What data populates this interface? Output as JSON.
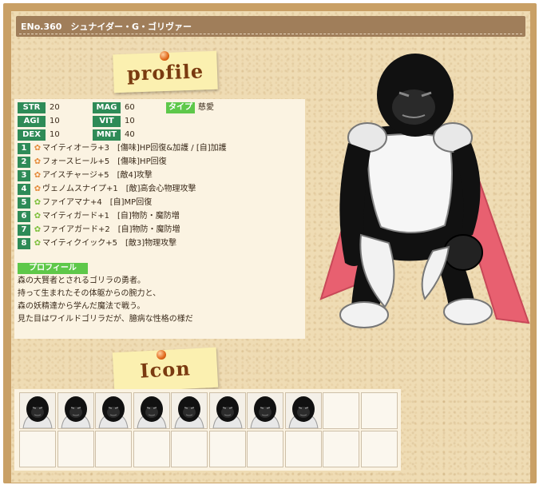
{
  "header": {
    "title": "ENo.360　シュナイダー・G・ゴリヴァー"
  },
  "notes": {
    "profile_word": "profile",
    "icon_word": "Icon"
  },
  "stats": [
    {
      "label": "STR",
      "value": "20"
    },
    {
      "label": "AGI",
      "value": "10"
    },
    {
      "label": "DEX",
      "value": "10"
    },
    {
      "label": "MAG",
      "value": "60"
    },
    {
      "label": "VIT",
      "value": "10"
    },
    {
      "label": "MNT",
      "value": "40"
    }
  ],
  "type": {
    "label": "タイプ",
    "value": "慈愛"
  },
  "skills": [
    {
      "num": "1",
      "flower_color": "#e58a3a",
      "text": "マイティオーラ+3　[傷味]HP回復&加護 / [自]加護"
    },
    {
      "num": "2",
      "flower_color": "#e58a3a",
      "text": "フォースヒール+5　[傷味]HP回復"
    },
    {
      "num": "3",
      "flower_color": "#e58a3a",
      "text": "アイスチャージ+5　[敵4]攻撃"
    },
    {
      "num": "4",
      "flower_color": "#e58a3a",
      "text": "ヴェノムスナイプ+1　[敵]高会心物理攻撃"
    },
    {
      "num": "5",
      "flower_color": "#7cbf3a",
      "text": "ファイアマナ+4　[自]MP回復"
    },
    {
      "num": "6",
      "flower_color": "#7cbf3a",
      "text": "マイティガード+1　[自]物防・魔防増"
    },
    {
      "num": "7",
      "flower_color": "#7cbf3a",
      "text": "ファイアガード+2　[自]物防・魔防増"
    },
    {
      "num": "8",
      "flower_color": "#7cbf3a",
      "text": "マイティクイック+5　[敵3]物理攻撃"
    }
  ],
  "profile": {
    "tag": "プロフィール",
    "lines": [
      "森の大賢者とされるゴリラの勇者。",
      "持って生まれたその体躯からの腕力と、",
      "森の妖精達から学んだ魔法で戦う。",
      "見た目はワイルドゴリラだが、臆病な性格の様だ"
    ]
  },
  "icons": {
    "filled": 8,
    "total": 20
  },
  "colors": {
    "stat_green": "#2e8b57",
    "tag_green": "#5ec84a",
    "header_brown": "#a07e5a",
    "cape_red": "#e86070"
  }
}
